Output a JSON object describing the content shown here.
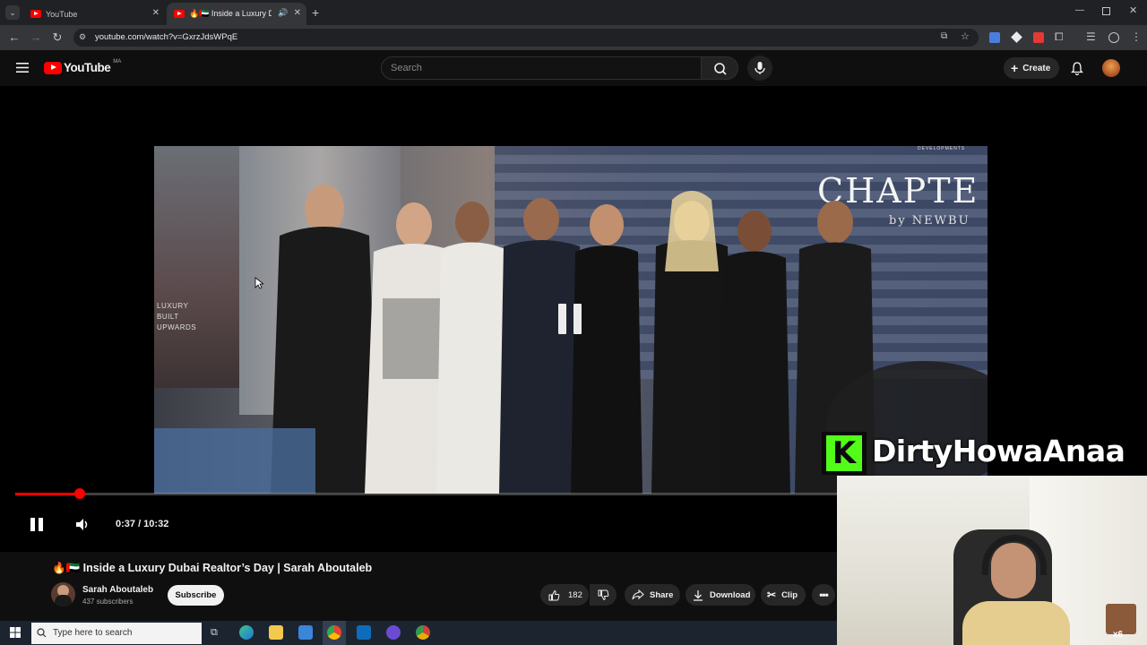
{
  "browser": {
    "tabs": [
      {
        "label": "YouTube",
        "active": false
      },
      {
        "label": "🔥🇦🇪 Inside a Luxury Dubai",
        "active": true
      }
    ],
    "url": "youtube.com/watch?v=GxrzJdsWPqE"
  },
  "youtube": {
    "logo_text": "YouTube",
    "country_code": "MA",
    "search_placeholder": "Search",
    "create_label": "Create"
  },
  "player": {
    "time": "0:37 / 10:32",
    "progress_fraction": 0.058,
    "state": "playing",
    "video_sign_text": "CHAPTE",
    "video_sign_sub": "by NEWBU",
    "video_sign_top": "DEVELOPMENTS",
    "video_billboard": [
      "LUXURY",
      "BUILT",
      "UPWARDS"
    ]
  },
  "video": {
    "title": "🔥🇦🇪 Inside a Luxury Dubai Realtor’s Day | Sarah Aboutaleb",
    "channel": "Sarah Aboutaleb",
    "subscribers": "437 subscribers",
    "subscribe_label": "Subscribe",
    "likes": "182",
    "share_label": "Share",
    "download_label": "Download",
    "clip_label": "Clip"
  },
  "overlay": {
    "badge_letter": "K",
    "streamer_name": "DirtyHowaAnaa"
  },
  "taskbar": {
    "search_placeholder": "Type here to search"
  },
  "colors": {
    "accent": "#ff0000",
    "background": "#0f0f0f",
    "kick_green": "#53fc18"
  }
}
